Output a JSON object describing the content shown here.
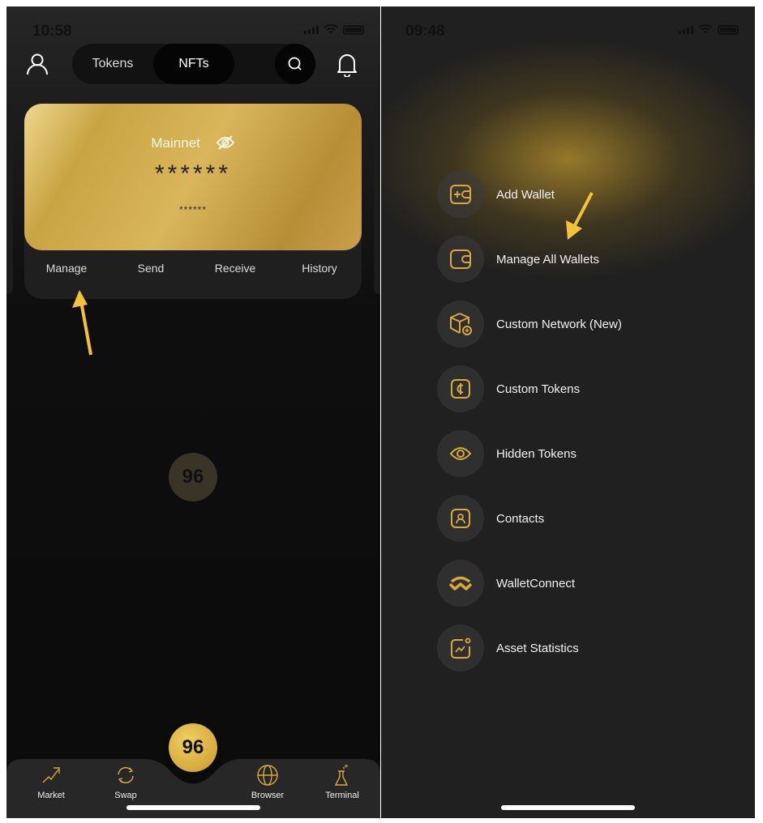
{
  "accent": "#d9a93d",
  "left": {
    "status": {
      "time": "10:58"
    },
    "header": {
      "tabs": [
        {
          "label": "Tokens"
        },
        {
          "label": "NFTs"
        }
      ],
      "active_tab": "NFTs",
      "icons": [
        "user-icon",
        "search-icon",
        "bell-icon"
      ]
    },
    "card": {
      "network": "Mainnet",
      "balance": "******",
      "sub_balance": "******",
      "visibility_icon": "eye-off-icon"
    },
    "actions": [
      {
        "label": "Manage"
      },
      {
        "label": "Send"
      },
      {
        "label": "Receive"
      },
      {
        "label": "History"
      }
    ],
    "tabbar": [
      {
        "label": "Market",
        "icon": "chart-arrow-icon"
      },
      {
        "label": "Swap",
        "icon": "swap-icon"
      },
      {
        "label": "Browser",
        "icon": "globe-icon"
      },
      {
        "label": "Terminal",
        "icon": "flask-icon"
      }
    ]
  },
  "right": {
    "status": {
      "time": "09:48"
    },
    "menu": [
      {
        "label": "Add Wallet",
        "icon": "add-wallet-icon"
      },
      {
        "label": "Manage All Wallets",
        "icon": "wallet-icon"
      },
      {
        "label": "Custom Network",
        "badge": "(New)",
        "icon": "cube-plus-icon"
      },
      {
        "label": "Custom Tokens",
        "icon": "coin-icon"
      },
      {
        "label": "Hidden Tokens",
        "icon": "eye-icon"
      },
      {
        "label": "Contacts",
        "icon": "contact-icon"
      },
      {
        "label": "WalletConnect",
        "icon": "walletconnect-icon"
      },
      {
        "label": "Asset Statistics",
        "icon": "stats-icon"
      }
    ]
  }
}
